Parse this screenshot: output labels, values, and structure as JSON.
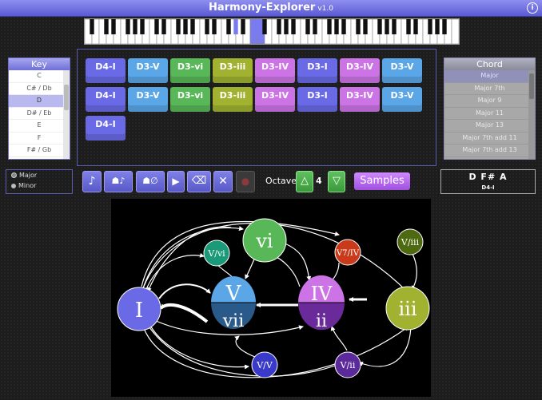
{
  "app": {
    "title": "Harmony-Explorer",
    "version": "v1.0",
    "info_icon": "info-icon"
  },
  "piano": {
    "white_keys": 52,
    "highlighted_white": [
      23,
      24
    ],
    "highlighted_black_index": [
      14,
      16
    ],
    "highlight_color": "#7b7bf0"
  },
  "key_panel": {
    "header": "Key",
    "items": [
      "C",
      "C# / Db",
      "D",
      "D# / Eb",
      "E",
      "F",
      "F# / Gb"
    ],
    "selected": "D"
  },
  "chord_panel": {
    "header": "Chord",
    "items": [
      "Major",
      "Major 7th",
      "Major 9",
      "Major 11",
      "Major 13",
      "Major 7th add 11",
      "Major 7th add 13"
    ],
    "selected": "Major"
  },
  "sequence": {
    "rows": [
      [
        {
          "label": "D4-I",
          "color": "#6a6ae6"
        },
        {
          "label": "D3-V",
          "color": "#5aa6e6"
        },
        {
          "label": "D3-vi",
          "color": "#58b858"
        },
        {
          "label": "D3-iii",
          "color": "#a0b230"
        },
        {
          "label": "D3-IV",
          "color": "#cc74e6"
        },
        {
          "label": "D3-I",
          "color": "#6a6ae6"
        },
        {
          "label": "D3-IV",
          "color": "#cc74e6"
        },
        {
          "label": "D3-V",
          "color": "#5aa6e6"
        }
      ],
      [
        {
          "label": "D4-I",
          "color": "#6a6ae6"
        },
        {
          "label": "D3-V",
          "color": "#5aa6e6"
        },
        {
          "label": "D3-vi",
          "color": "#58b858"
        },
        {
          "label": "D3-iii",
          "color": "#a0b230"
        },
        {
          "label": "D3-IV",
          "color": "#cc74e6"
        },
        {
          "label": "D3-I",
          "color": "#6a6ae6"
        },
        {
          "label": "D3-IV",
          "color": "#cc74e6"
        },
        {
          "label": "D3-V",
          "color": "#5aa6e6"
        }
      ],
      [
        {
          "label": "D4-I",
          "color": "#6a6ae6"
        }
      ]
    ]
  },
  "mode": {
    "options": [
      "Major",
      "Minor"
    ],
    "selected": "Major"
  },
  "toolbar": {
    "buttons": [
      {
        "name": "note-icon",
        "glyph": "♪"
      },
      {
        "name": "add-chord-note-icon",
        "glyph": "☗♪"
      },
      {
        "name": "add-rest-icon",
        "glyph": "☗∅"
      },
      {
        "name": "play-icon",
        "glyph": "▶"
      },
      {
        "name": "backspace-icon",
        "glyph": "⌫"
      },
      {
        "name": "clear-icon",
        "glyph": "✕"
      },
      {
        "name": "record-icon",
        "glyph": "●"
      }
    ],
    "octave_label": "Octave",
    "octave_up": "△",
    "octave_value": "4",
    "octave_down": "▽",
    "samples_label": "Samples"
  },
  "chord_display": {
    "notes": "D  F#  A",
    "name": "D4-I"
  },
  "diagram": {
    "nodes": {
      "I": "I",
      "V": "V",
      "vii": "vii",
      "vi": "vi",
      "V_vi": "V/vi",
      "V7_IV": "V7/IV",
      "IV": "IV",
      "ii": "ii",
      "iii": "iii",
      "V_iii": "V/iii",
      "V_V": "V/V",
      "V_ii": "V/ii"
    },
    "colors": {
      "I": "#6a6ae6",
      "V": "#5aa6e6",
      "vii": "#2a5a8a",
      "vi": "#58b858",
      "V_vi": "#1a9a78",
      "V7_IV": "#c83a1a",
      "IV": "#cc74e6",
      "ii": "#6a2a9a",
      "iii": "#a0b230",
      "V_iii": "#4e6a10",
      "V_V": "#3a3aca",
      "V_ii": "#5a2a9a"
    }
  }
}
